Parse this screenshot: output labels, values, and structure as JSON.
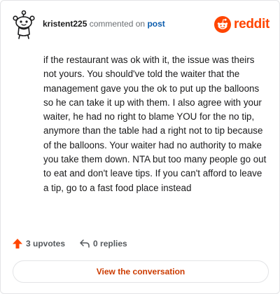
{
  "header": {
    "username": "kristent225",
    "action_text": "commented on",
    "post_link": "post",
    "logo_text": "reddit"
  },
  "comment": {
    "body": "if the restaurant was ok with it, the issue was theirs not yours. You should've told the waiter that the management gave you the ok to put up the balloons so he can take it up with them. I also agree with your waiter, he had no right to blame YOU for the no tip, anymore than the table had a right not to tip because of the balloons. Your waiter had no authority to make you take them down. NTA but too many people go out to eat and don't leave tips. If you can't afford to leave a tip, go to a fast food place instead"
  },
  "stats": {
    "upvotes": "3 upvotes",
    "replies": "0 replies"
  },
  "cta": {
    "label": "View the conversation"
  },
  "colors": {
    "accent": "#ff4500",
    "link": "#0b5cad",
    "cta_text": "#cc3b00"
  },
  "icons": {
    "avatar": "avatar-icon",
    "logo": "reddit-snoo-icon",
    "upvote": "upvote-arrow-icon",
    "reply": "reply-arrow-icon"
  }
}
